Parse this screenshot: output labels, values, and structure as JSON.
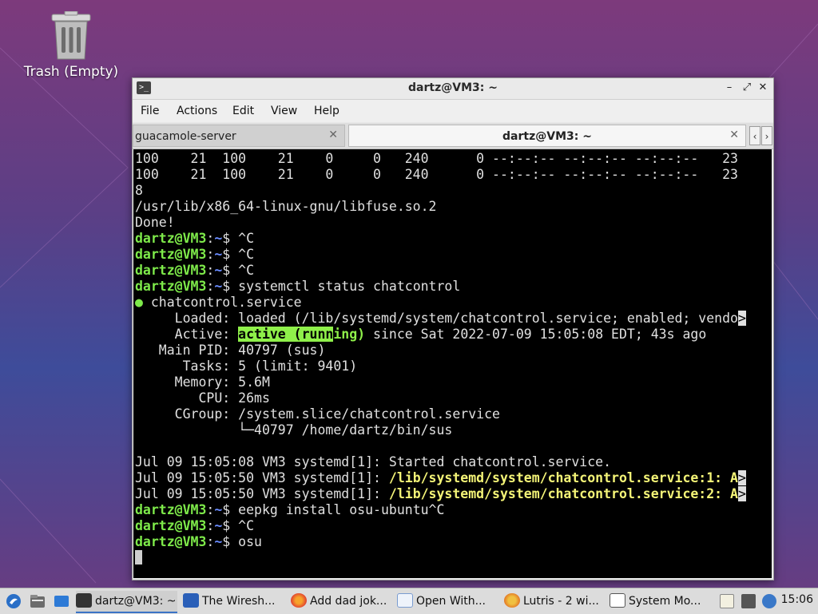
{
  "desktop": {
    "trash_label": "Trash (Empty)"
  },
  "window": {
    "title": "dartz@VM3: ~",
    "controls": {
      "minimize": "–",
      "maximize": "⤢",
      "close": "✕"
    }
  },
  "menubar": [
    "File",
    "Actions",
    "Edit",
    "View",
    "Help"
  ],
  "tabs": [
    {
      "label": "guacamole-server",
      "active": false
    },
    {
      "label": "dartz@VM3: ~",
      "active": true
    }
  ],
  "terminal": {
    "lines": [
      [
        {
          "t": "100    21  100    21    0     0   240      0 --:--:-- --:--:-- --:--:--   23"
        }
      ],
      [
        {
          "t": "100    21  100    21    0     0   240      0 --:--:-- --:--:-- --:--:--   23"
        }
      ],
      [
        {
          "t": "8"
        }
      ],
      [
        {
          "t": "/usr/lib/x86_64-linux-gnu/libfuse.so.2"
        }
      ],
      [
        {
          "t": "Done!"
        }
      ],
      [
        {
          "t": "dartz@VM3",
          "s": "prompt-user"
        },
        {
          "t": ":"
        },
        {
          "t": "~",
          "s": "prompt-path"
        },
        {
          "t": "$ ^C"
        }
      ],
      [
        {
          "t": "dartz@VM3",
          "s": "prompt-user"
        },
        {
          "t": ":"
        },
        {
          "t": "~",
          "s": "prompt-path"
        },
        {
          "t": "$ ^C"
        }
      ],
      [
        {
          "t": "dartz@VM3",
          "s": "prompt-user"
        },
        {
          "t": ":"
        },
        {
          "t": "~",
          "s": "prompt-path"
        },
        {
          "t": "$ ^C"
        }
      ],
      [
        {
          "t": "dartz@VM3",
          "s": "prompt-user"
        },
        {
          "t": ":"
        },
        {
          "t": "~",
          "s": "prompt-path"
        },
        {
          "t": "$ systemctl status chatcontrol"
        }
      ],
      [
        {
          "t": "●",
          "s": "dot"
        },
        {
          "t": " chatcontrol.service"
        }
      ],
      [
        {
          "t": "     Loaded: loaded (/lib/systemd/system/chatcontrol.service; enabled; vendo"
        },
        {
          "t": ">",
          "s": "trunc"
        }
      ],
      [
        {
          "t": "     Active: "
        },
        {
          "t": "active (runn",
          "s": "green-bg"
        },
        {
          "t": "ing)",
          "s": "green-fg"
        },
        {
          "t": " since Sat 2022-07-09 15:05:08 EDT; 43s ago"
        }
      ],
      [
        {
          "t": "   Main PID: 40797 (sus)"
        }
      ],
      [
        {
          "t": "      Tasks: 5 (limit: 9401)"
        }
      ],
      [
        {
          "t": "     Memory: 5.6M"
        }
      ],
      [
        {
          "t": "        CPU: 26ms"
        }
      ],
      [
        {
          "t": "     CGroup: /system.slice/chatcontrol.service"
        }
      ],
      [
        {
          "t": "             └─40797 /home/dartz/bin/sus"
        }
      ],
      [
        {
          "t": ""
        }
      ],
      [
        {
          "t": "Jul 09 15:05:08 VM3 systemd[1]: Started chatcontrol.service."
        }
      ],
      [
        {
          "t": "Jul 09 15:05:50 VM3 systemd[1]: "
        },
        {
          "t": "/lib/systemd/system/chatcontrol.service:1: A",
          "s": "bold-yellow"
        },
        {
          "t": ">",
          "s": "trunc"
        }
      ],
      [
        {
          "t": "Jul 09 15:05:50 VM3 systemd[1]: "
        },
        {
          "t": "/lib/systemd/system/chatcontrol.service:2: A",
          "s": "bold-yellow"
        },
        {
          "t": ">",
          "s": "trunc"
        }
      ],
      [
        {
          "t": "dartz@VM3",
          "s": "prompt-user"
        },
        {
          "t": ":"
        },
        {
          "t": "~",
          "s": "prompt-path"
        },
        {
          "t": "$ eepkg install osu-ubuntu^C"
        }
      ],
      [
        {
          "t": "dartz@VM3",
          "s": "prompt-user"
        },
        {
          "t": ":"
        },
        {
          "t": "~",
          "s": "prompt-path"
        },
        {
          "t": "$ ^C"
        }
      ],
      [
        {
          "t": "dartz@VM3",
          "s": "prompt-user"
        },
        {
          "t": ":"
        },
        {
          "t": "~",
          "s": "prompt-path"
        },
        {
          "t": "$ osu"
        }
      ],
      [
        {
          "t": "",
          "s": "cursor"
        }
      ]
    ]
  },
  "taskbar": {
    "tasks": [
      {
        "label": "dartz@VM3: ~",
        "icon": "terminal-icon",
        "active": true
      },
      {
        "label": "The Wiresh...",
        "icon": "wireshark-icon",
        "active": false
      },
      {
        "label": "Add dad jok...",
        "icon": "firefox-icon",
        "active": false
      },
      {
        "label": "Open With...",
        "icon": "window-icon",
        "active": false
      },
      {
        "label": "Lutris - 2 wi...",
        "icon": "lutris-icon",
        "active": false
      },
      {
        "label": "System Mo...",
        "icon": "system-monitor-icon",
        "active": false
      }
    ],
    "clock": "15:06"
  }
}
